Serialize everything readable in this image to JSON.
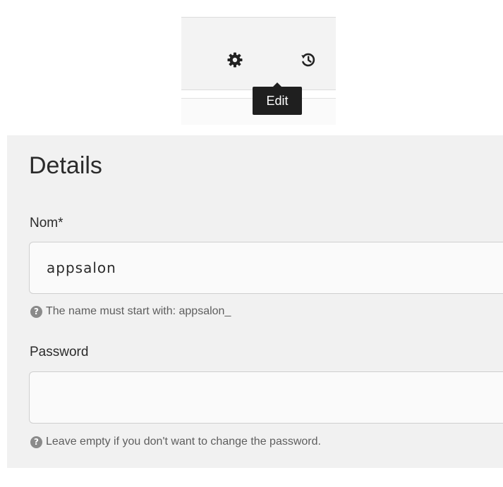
{
  "toolbar": {
    "settings_icon": "gear-icon",
    "history_icon": "history-icon",
    "tooltip": "Edit"
  },
  "details": {
    "title": "Details",
    "fields": [
      {
        "label": "Nom*",
        "value": "appsalon",
        "placeholder": "",
        "help": "The name must start with: appsalon_"
      },
      {
        "label": "Password",
        "value": "",
        "placeholder": "",
        "help": "Leave empty if you don't want to change the password."
      }
    ]
  },
  "colors": {
    "panel_bg": "#f1f1f1",
    "toolbar_bg": "#f3f3f3",
    "tooltip_bg": "#1f1f1f",
    "text": "#2b2b2b",
    "help_text": "#5e5e5e"
  }
}
